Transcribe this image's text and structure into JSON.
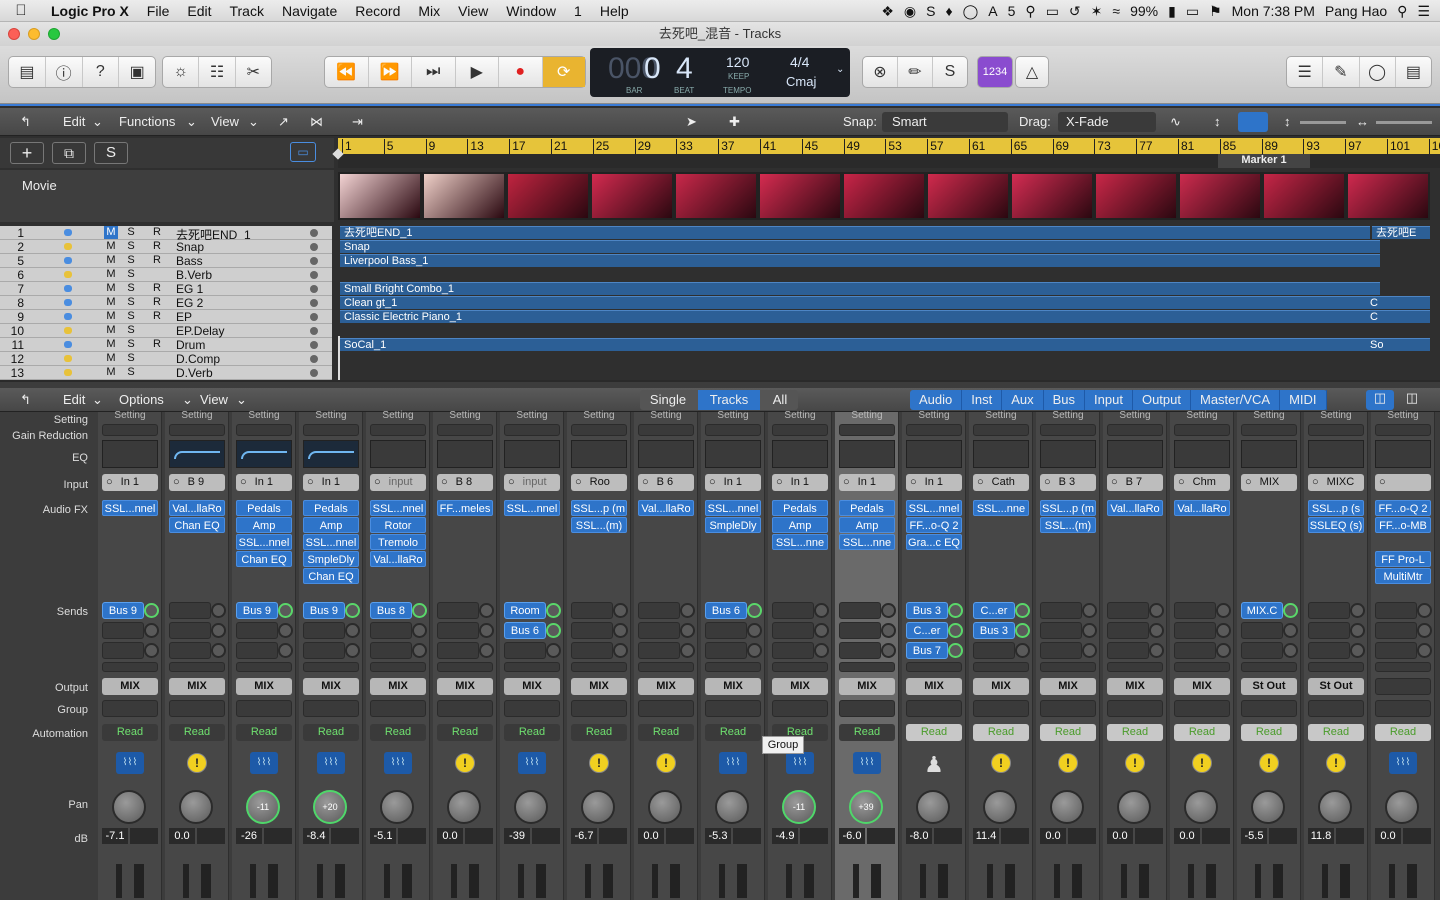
{
  "menubar": {
    "app": "Logic Pro X",
    "items": [
      "File",
      "Edit",
      "Track",
      "Navigate",
      "Record",
      "Mix",
      "View",
      "Window",
      "1",
      "Help"
    ],
    "battery": "99%",
    "time": "Mon 7:38 PM",
    "user": "Pang Hao",
    "badge": "5"
  },
  "window": {
    "title": "去死吧_混音 - Tracks"
  },
  "lcd": {
    "bar": "0",
    "beat": "4",
    "bar_ghost": "000",
    "bar_label": "BAR",
    "beat_label": "BEAT",
    "tempo": "120",
    "keep": "KEEP",
    "tempo_label": "TEMPO",
    "sig": "4/4",
    "key": "Cmaj"
  },
  "toolbar": {
    "count_in": "1234"
  },
  "tracks_ctl": {
    "edit": "Edit",
    "functions": "Functions",
    "view": "View",
    "snap_label": "Snap:",
    "snap_value": "Smart",
    "drag_label": "Drag:",
    "drag_value": "X-Fade"
  },
  "ruler": {
    "ticks": [
      "1",
      "5",
      "9",
      "13",
      "17",
      "21",
      "25",
      "29",
      "33",
      "37",
      "41",
      "45",
      "49",
      "53",
      "57",
      "61",
      "65",
      "69",
      "73",
      "77",
      "81",
      "85",
      "89",
      "93",
      "97",
      "101",
      "10"
    ],
    "marker": "Marker 1"
  },
  "movie": {
    "label": "Movie"
  },
  "header_buttons": {
    "s": "S"
  },
  "track_list": [
    {
      "num": "1",
      "m": "M",
      "s": "S",
      "r": "R",
      "name": "去死吧END_1"
    },
    {
      "num": "2",
      "m": "M",
      "s": "S",
      "r": "R",
      "name": "Snap"
    },
    {
      "num": "5",
      "m": "M",
      "s": "S",
      "r": "R",
      "name": "Bass"
    },
    {
      "num": "6",
      "m": "M",
      "s": "S",
      "r": "",
      "name": "B.Verb"
    },
    {
      "num": "7",
      "m": "M",
      "s": "S",
      "r": "R",
      "name": "EG 1"
    },
    {
      "num": "8",
      "m": "M",
      "s": "S",
      "r": "R",
      "name": "EG 2"
    },
    {
      "num": "9",
      "m": "M",
      "s": "S",
      "r": "R",
      "name": "EP"
    },
    {
      "num": "10",
      "m": "M",
      "s": "S",
      "r": "",
      "name": "EP.Delay"
    },
    {
      "num": "11",
      "m": "M",
      "s": "S",
      "r": "R",
      "name": "Drum"
    },
    {
      "num": "12",
      "m": "M",
      "s": "S",
      "r": "",
      "name": "D.Comp"
    },
    {
      "num": "13",
      "m": "M",
      "s": "S",
      "r": "",
      "name": "D.Verb"
    }
  ],
  "regions": [
    {
      "name": "去死吧END_1",
      "row": 0
    },
    {
      "name": "Snap",
      "row": 1
    },
    {
      "name": "Liverpool Bass_1",
      "row": 2
    },
    {
      "name": "Small Bright Combo_1",
      "row": 4
    },
    {
      "name": "Clean gt_1",
      "row": 5
    },
    {
      "name": "Classic Electric Piano_1",
      "row": 6
    },
    {
      "name": "SoCal_1",
      "row": 8
    }
  ],
  "region_tail": {
    "r0": "去死吧E",
    "c5": "C",
    "c6": "C",
    "so": "So"
  },
  "mixer_ctl": {
    "edit": "Edit",
    "options": "Options",
    "view": "View",
    "single": "Single",
    "tracks": "Tracks",
    "all": "All"
  },
  "mixer_filters": [
    "Audio",
    "Inst",
    "Aux",
    "Bus",
    "Input",
    "Output",
    "Master/VCA",
    "MIDI"
  ],
  "mixer_labels": {
    "setting": "Setting",
    "gain": "Gain Reduction",
    "eq": "EQ",
    "input": "Input",
    "fx": "Audio FX",
    "sends": "Sends",
    "output": "Output",
    "group": "Group",
    "automation": "Automation",
    "pan": "Pan",
    "db": "dB"
  },
  "tooltip": "Group",
  "strips": [
    {
      "setting": "Setting",
      "input": "In 1",
      "fx": [
        "SSL...nnel"
      ],
      "sends": [
        {
          "n": "Bus 9",
          "g": true
        }
      ],
      "out": "MIX",
      "auto": "Read",
      "icon": "wave",
      "pan": "",
      "db": "-7.1"
    },
    {
      "setting": "Setting",
      "input": "B 9",
      "fx": [
        "Val...llaRo",
        "Chan EQ"
      ],
      "sends": [],
      "out": "MIX",
      "auto": "Read",
      "icon": "yel",
      "pan": "",
      "db": "0.0",
      "eq": true
    },
    {
      "setting": "Setting",
      "input": "In 1",
      "fx": [
        "Pedals",
        "Amp",
        "SSL...nnel",
        "Chan EQ"
      ],
      "sends": [
        {
          "n": "Bus 9",
          "g": true
        }
      ],
      "out": "MIX",
      "auto": "Read",
      "icon": "wave",
      "pan": "-11",
      "db": "-26",
      "eq": true
    },
    {
      "setting": "Setting",
      "input": "In 1",
      "fx": [
        "Pedals",
        "Amp",
        "SSL...nnel",
        "SmpleDly",
        "Chan EQ"
      ],
      "sends": [
        {
          "n": "Bus 9",
          "g": true
        }
      ],
      "out": "MIX",
      "auto": "Read",
      "icon": "wave",
      "pan": "+20",
      "db": "-8.4",
      "eq": true
    },
    {
      "setting": "Setting",
      "input": "input",
      "fx": [
        "SSL...nnel",
        "Rotor",
        "Tremolo",
        "Val...llaRo"
      ],
      "sends": [
        {
          "n": "Bus 8",
          "g": true
        }
      ],
      "out": "MIX",
      "auto": "Read",
      "icon": "wave",
      "pan": "",
      "db": "-5.1"
    },
    {
      "setting": "Setting",
      "input": "B 8",
      "fx": [
        "FF...meles"
      ],
      "sends": [],
      "out": "MIX",
      "auto": "Read",
      "icon": "yel",
      "pan": "",
      "db": "0.0"
    },
    {
      "setting": "Setting",
      "input": "input",
      "fx": [
        "SSL...nnel"
      ],
      "sends": [
        {
          "n": "Room",
          "g": true
        },
        {
          "n": "Bus 6",
          "g": true
        }
      ],
      "out": "MIX",
      "auto": "Read",
      "icon": "wave",
      "pan": "",
      "db": "-39"
    },
    {
      "setting": "Setting",
      "input": "Roo",
      "fx": [
        "SSL...p (m",
        "SSL...(m)"
      ],
      "sends": [],
      "out": "MIX",
      "auto": "Read",
      "icon": "yel",
      "pan": "",
      "db": "-6.7"
    },
    {
      "setting": "Setting",
      "input": "B 6",
      "fx": [
        "Val...llaRo"
      ],
      "sends": [],
      "out": "MIX",
      "auto": "Read",
      "icon": "yel",
      "pan": "",
      "db": "0.0"
    },
    {
      "setting": "Setting",
      "input": "In 1",
      "fx": [
        "SSL...nnel",
        "SmpleDly"
      ],
      "sends": [
        {
          "n": "Bus 6",
          "g": true
        }
      ],
      "out": "MIX",
      "auto": "Read",
      "icon": "wave",
      "pan": "",
      "db": "-5.3"
    },
    {
      "setting": "Setting",
      "input": "In 1",
      "fx": [
        "Pedals",
        "Amp",
        "SSL...nne"
      ],
      "sends": [],
      "out": "MIX",
      "auto": "Read",
      "icon": "wave",
      "pan": "-11",
      "db": "-4.9"
    },
    {
      "setting": "Setting",
      "input": "In 1",
      "fx": [
        "Pedals",
        "Amp",
        "SSL...nne"
      ],
      "sends": [],
      "out": "MIX",
      "auto": "Read",
      "icon": "wave",
      "pan": "+39",
      "db": "-6.0",
      "sel": true
    },
    {
      "setting": "Setting",
      "input": "In 1",
      "fx": [
        "SSL...nnel",
        "FF...o-Q 2",
        "Gra...c EQ"
      ],
      "sends": [
        {
          "n": "Bus 3",
          "g": true
        },
        {
          "n": "C...er",
          "g": true
        },
        {
          "n": "Bus 7",
          "g": true
        }
      ],
      "out": "MIX",
      "auto": "Read",
      "icon": "person",
      "pan": "",
      "db": "-8.0"
    },
    {
      "setting": "Setting",
      "input": "Cath",
      "fx": [
        "SSL...nne"
      ],
      "sends": [
        {
          "n": "C...er",
          "g": true
        },
        {
          "n": "Bus 3",
          "g": true
        }
      ],
      "out": "MIX",
      "auto": "Read",
      "icon": "yel",
      "pan": "",
      "db": "11.4"
    },
    {
      "setting": "Setting",
      "input": "B 3",
      "fx": [
        "SSL...p (m",
        "SSL...(m)"
      ],
      "sends": [],
      "out": "MIX",
      "auto": "Read",
      "icon": "yel",
      "pan": "",
      "db": "0.0"
    },
    {
      "setting": "Setting",
      "input": "B 7",
      "fx": [
        "Val...llaRo"
      ],
      "sends": [],
      "out": "MIX",
      "auto": "Read",
      "icon": "yel",
      "pan": "",
      "db": "0.0"
    },
    {
      "setting": "Setting",
      "input": "Chm",
      "fx": [
        "Val...llaRo"
      ],
      "sends": [],
      "out": "MIX",
      "auto": "Read",
      "icon": "yel",
      "pan": "",
      "db": "0.0"
    },
    {
      "setting": "Setting",
      "input": "MIX",
      "fx": [],
      "sends": [
        {
          "n": "MIX.C",
          "g": true
        }
      ],
      "out": "St Out",
      "auto": "Read",
      "icon": "yel",
      "pan": "",
      "db": "-5.5"
    },
    {
      "setting": "Setting",
      "input": "MIXC",
      "fx": [
        "SSL...p (s",
        "SSLEQ (s)"
      ],
      "sends": [],
      "out": "St Out",
      "auto": "Read",
      "icon": "yel",
      "pan": "",
      "db": "11.8"
    },
    {
      "setting": "Setting",
      "input": "",
      "fx": [
        "FF...o-Q 2",
        "FF...o-MB",
        "",
        "FF Pro-L",
        "MultiMtr"
      ],
      "sends": [],
      "out": "",
      "auto": "Read",
      "icon": "wave",
      "pan": "",
      "db": "0.0"
    }
  ],
  "colors": {
    "accent": "#2e74c9",
    "selected_bg": "#6a6a6a",
    "ruler": "#e6c43a"
  }
}
